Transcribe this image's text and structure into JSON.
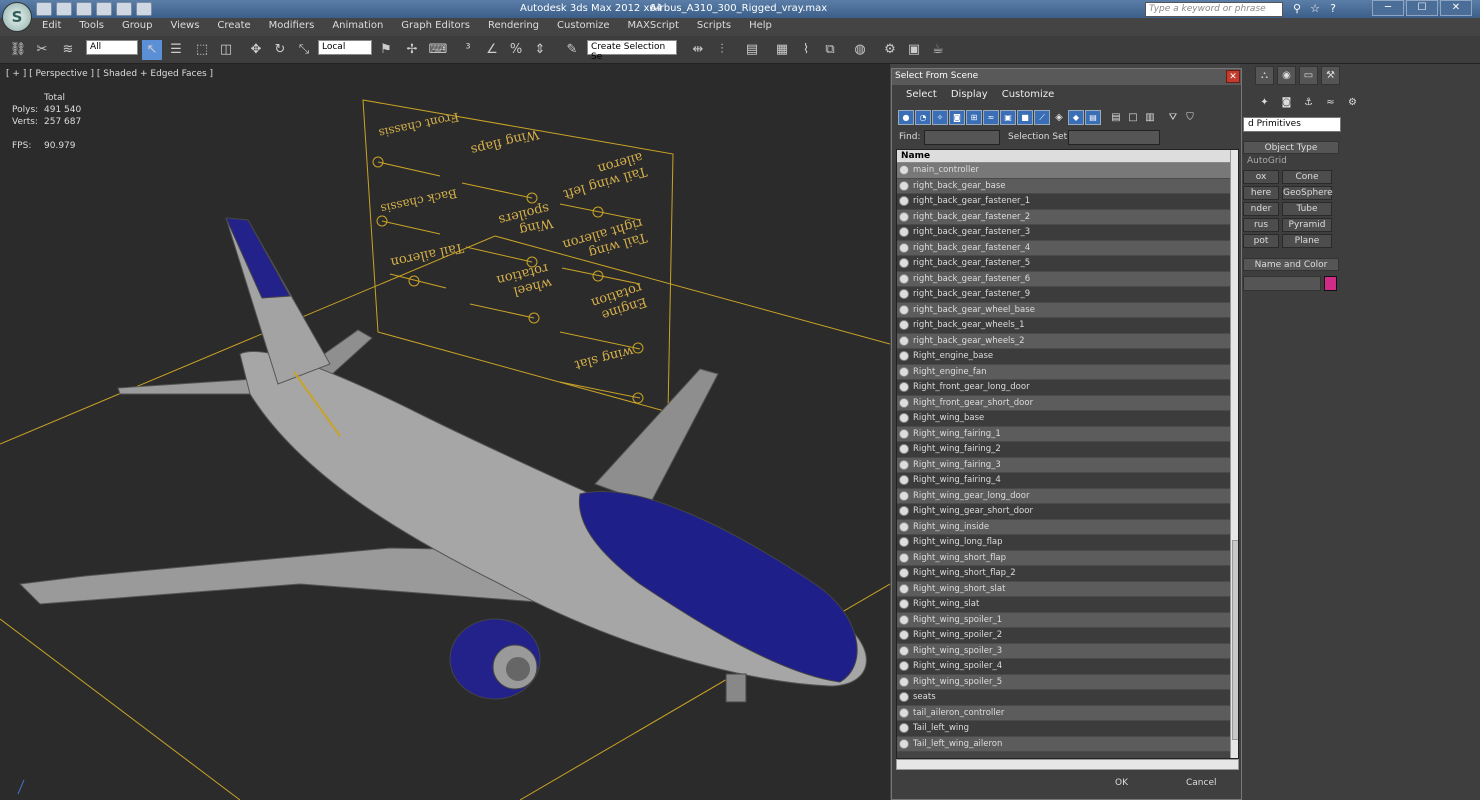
{
  "app": {
    "title": "Autodesk 3ds Max  2012 x64",
    "document": "Airbus_A310_300_Rigged_vray.max",
    "search_placeholder": "Type a keyword or phrase",
    "logo": "S"
  },
  "menu": [
    "Edit",
    "Tools",
    "Group",
    "Views",
    "Create",
    "Modifiers",
    "Animation",
    "Graph Editors",
    "Rendering",
    "Customize",
    "MAXScript",
    "Scripts",
    "Help"
  ],
  "toolbar": {
    "filter": "All",
    "coord": "Local",
    "selection_set": "Create Selection Se"
  },
  "viewport": {
    "label": "[ + ] [ Perspective ] [ Shaded + Edged Faces ]",
    "stats_header": "Total",
    "polys_label": "Polys:",
    "polys": "491 540",
    "verts_label": "Verts:",
    "verts": "257 687",
    "fps_label": "FPS:",
    "fps": "90.979",
    "rig_labels": [
      "Front chassis",
      "Wing flaps",
      "Tail wing left aileron",
      "Back chassis",
      "Wing spoilers",
      "Tail wing right aileron",
      "Tail aileron",
      "wheel rotation",
      "Engine rotation",
      "wing slat"
    ]
  },
  "dialog": {
    "title": "Select From Scene",
    "close": "✕",
    "menu": [
      "Select",
      "Display",
      "Customize"
    ],
    "find_label": "Find:",
    "selset_label": "Selection Set:",
    "column": "Name",
    "items": [
      "main_controller",
      "right_back_gear_base",
      "right_back_gear_fastener_1",
      "right_back_gear_fastener_2",
      "right_back_gear_fastener_3",
      "right_back_gear_fastener_4",
      "right_back_gear_fastener_5",
      "right_back_gear_fastener_6",
      "right_back_gear_fastener_9",
      "right_back_gear_wheel_base",
      "right_back_gear_wheels_1",
      "right_back_gear_wheels_2",
      "Right_engine_base",
      "Right_engine_fan",
      "Right_front_gear_long_door",
      "Right_front_gear_short_door",
      "Right_wing_base",
      "Right_wing_fairing_1",
      "Right_wing_fairing_2",
      "Right_wing_fairing_3",
      "Right_wing_fairing_4",
      "Right_wing_gear_long_door",
      "Right_wing_gear_short_door",
      "Right_wing_inside",
      "Right_wing_long_flap",
      "Right_wing_short_flap",
      "Right_wing_short_flap_2",
      "Right_wing_short_slat",
      "Right_wing_slat",
      "Right_wing_spoiler_1",
      "Right_wing_spoiler_2",
      "Right_wing_spoiler_3",
      "Right_wing_spoiler_4",
      "Right_wing_spoiler_5",
      "seats",
      "tail_aileron_controller",
      "Tail_left_wing",
      "Tail_left_wing_aileron"
    ],
    "ok": "OK",
    "cancel": "Cancel"
  },
  "command_panel": {
    "dropdown": "d Primitives",
    "object_type": "Object Type",
    "autogrid": "AutoGrid",
    "buttons": [
      "ox",
      "Cone",
      "here",
      "GeoSphere",
      "nder",
      "Tube",
      "rus",
      "Pyramid",
      "pot",
      "Plane"
    ],
    "name_color": "Name and Color",
    "swatch_color": "#d02c86"
  }
}
